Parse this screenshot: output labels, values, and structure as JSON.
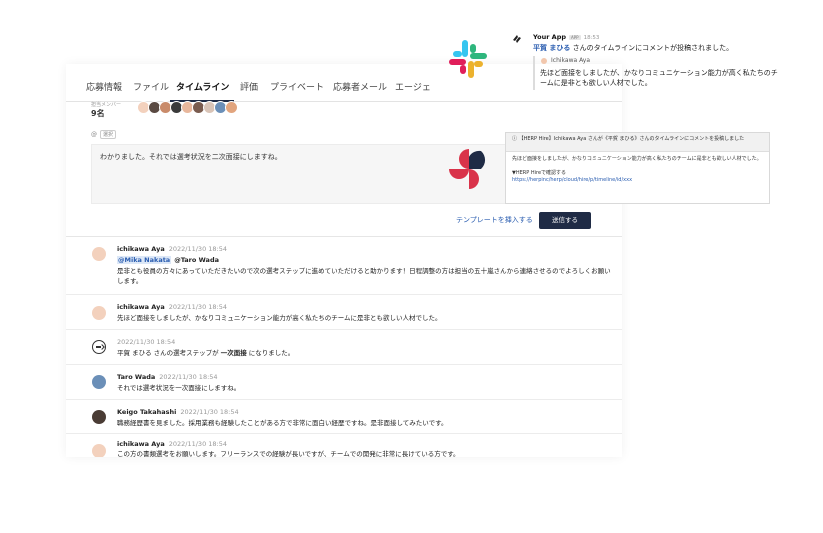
{
  "tabs": [
    "応募情報",
    "ファイル",
    "タイムライン",
    "評価",
    "プライベート",
    "応募者メール",
    "エージェ"
  ],
  "active_tab_index": 2,
  "members": {
    "label": "担当メンバー",
    "count": "9名"
  },
  "composer": {
    "mention_prefix": "@",
    "mention_tag": "選択",
    "text": "わかりました。それでは選考状況を二次面接にしますね。",
    "template_label": "テンプレートを挿入する",
    "send_label": "送信する"
  },
  "timeline": [
    {
      "name": "ichikawa Aya",
      "time": "2022/11/30 18:54",
      "mention": "@Mika Nakata",
      "mention2": "@Taro Wada",
      "text": "是非とも役員の方々にあっていただきたいので次の選考ステップに進めていただけると助かります！日程調整の方は担当の五十嵐さんから連絡させるのでよろしくお願いします。"
    },
    {
      "name": "ichikawa Aya",
      "time": "2022/11/30 18:54",
      "text": "先ほど面接をしましたが、かなりコミュニケーション能力が高く私たちのチームに是非とも欲しい人材でした。"
    },
    {
      "time": "2022/11/30 18:54",
      "text_pre": "平賀 まひる さんの選考ステップが ",
      "text_bold": "一次面接",
      "text_post": " になりました。"
    },
    {
      "name": "Taro Wada",
      "time": "2022/11/30 18:54",
      "text": "それでは選考状況を一次面接にしますね。"
    },
    {
      "name": "Keigo Takahashi",
      "time": "2022/11/30 18:54",
      "text": "職務経歴書を見ました。採用業務も経験したことがある方で非常に面白い経歴ですね。是非面接してみたいです。"
    },
    {
      "name": "ichikawa Aya",
      "time": "2022/11/30 18:54",
      "text": "この方の書類選考をお願いします。フリーランスでの経験が長いですが、チームでの開発に非常に長けている方です。"
    }
  ],
  "slack": {
    "app_name": "Your App",
    "badge": "APP",
    "time": "18:53",
    "title_link": "平賀 まひる",
    "title_rest": " さんのタイムラインにコメントが投稿されました。",
    "quote_name": "Ichikawa Aya",
    "quote_text": "先ほど面接をしましたが、かなりコミュニケーション能力が高く私たちのチームに是非とも欲しい人材でした。"
  },
  "email": {
    "head": "ⓘ 【HERP Hire】Ichikawa Aya さんが《平賀 まひる》さんのタイムラインにコメントを投稿しました",
    "body": "先ほど面接をしましたが、かなりコミュニケーション能力が高く私たちのチームに是非とも欲しい人材でした。",
    "link_label": "▼HERP Hireで確認する",
    "url": "https://herpinc/herp/cloud/hire/p/timeline/id/xxx"
  },
  "colors": {
    "primary": "#1f2b45",
    "link": "#2a5db0",
    "slack_blue": "#36C5F0",
    "slack_green": "#2EB67D",
    "slack_yellow": "#ECB22E",
    "slack_red": "#E01E5A",
    "pin_red": "#d9334a",
    "pin_dark": "#1f2b45"
  }
}
